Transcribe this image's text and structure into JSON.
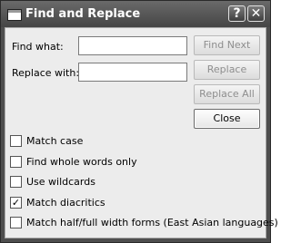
{
  "window": {
    "title": "Find and Replace",
    "help_button": "?",
    "close_button": "✕"
  },
  "fields": {
    "find_label": "Find what:",
    "find_value": "",
    "replace_label": "Replace with:",
    "replace_value": ""
  },
  "buttons": {
    "find_next": "Find Next",
    "replace": "Replace",
    "replace_all": "Replace All",
    "close": "Close"
  },
  "options": [
    {
      "label": "Match case",
      "checked": false
    },
    {
      "label": "Find whole words only",
      "checked": false
    },
    {
      "label": "Use wildcards",
      "checked": false
    },
    {
      "label": "Match diacritics",
      "checked": true
    },
    {
      "label": "Match half/full width forms (East Asian languages)",
      "checked": false
    }
  ]
}
